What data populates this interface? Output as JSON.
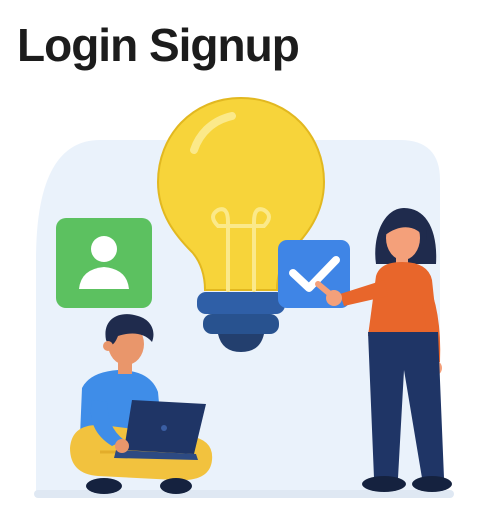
{
  "page": {
    "title": "Login Signup"
  },
  "illustration": {
    "icons": [
      "user-avatar-icon",
      "checkmark-icon",
      "lightbulb-icon",
      "laptop-icon"
    ],
    "figures": [
      "man-with-laptop",
      "woman-pointing"
    ]
  },
  "colors": {
    "title_text": "#1c1c1c",
    "backdrop": "#eaf2fb",
    "bulb_yellow": "#f7d43a",
    "bulb_base": "#2f5fa7",
    "user_card_green": "#5cc160",
    "check_card_blue": "#3f85e6",
    "woman_top": "#e8662b",
    "pants_navy": "#1f3566",
    "man_shirt": "#3f8de8",
    "man_pants": "#f2c23e",
    "laptop": "#1f3566"
  }
}
